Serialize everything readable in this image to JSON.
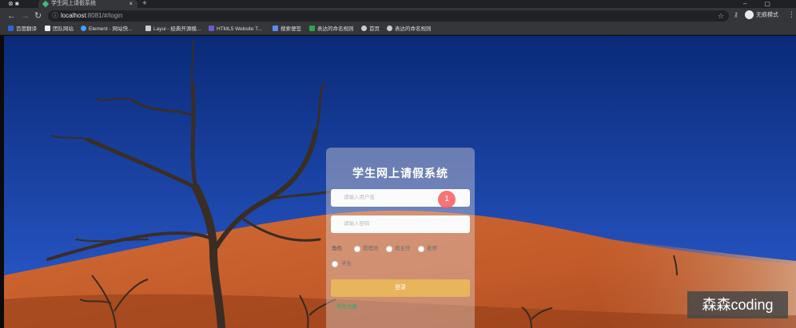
{
  "browser": {
    "tab_title": "学生网上请假系统",
    "url_host": "localhost",
    "url_path": ":8081/#/login",
    "profile_label": "无痕模式",
    "bookmarks": [
      {
        "label": "百度翻译",
        "color": "#2b63d9"
      },
      {
        "label": "团队网站",
        "color": "#eeeeee"
      },
      {
        "label": "Element - 网站快...",
        "color": "#409eff"
      },
      {
        "label": "Layui - 经典开源模...",
        "color": "#cccccc"
      },
      {
        "label": "HTML5 Website T...",
        "color": "#6a5acd"
      },
      {
        "label": "搜索便签",
        "color": "#5b8def"
      },
      {
        "label": "表达的命名规则",
        "color": "#2ea44f"
      },
      {
        "label": "首页",
        "color": "#cccccc"
      },
      {
        "label": "表达的命名规则",
        "color": "#cccccc"
      }
    ]
  },
  "login": {
    "title": "学生网上请假系统",
    "username_placeholder": "请输入用户名",
    "password_placeholder": "请输入密码",
    "role_label": "角色",
    "roles": [
      "管理员",
      "班主任",
      "老师",
      "学生"
    ],
    "login_button": "登录",
    "register_link": "学生注册"
  },
  "overlay": {
    "cursor_marker": "1",
    "watermark": "森森coding"
  },
  "colors": {
    "sky_top": "#0a2a78",
    "sky_bottom": "#2b5cd0",
    "dune": "#c8602e",
    "button": "#e7b55c",
    "register_link": "#13b573"
  }
}
